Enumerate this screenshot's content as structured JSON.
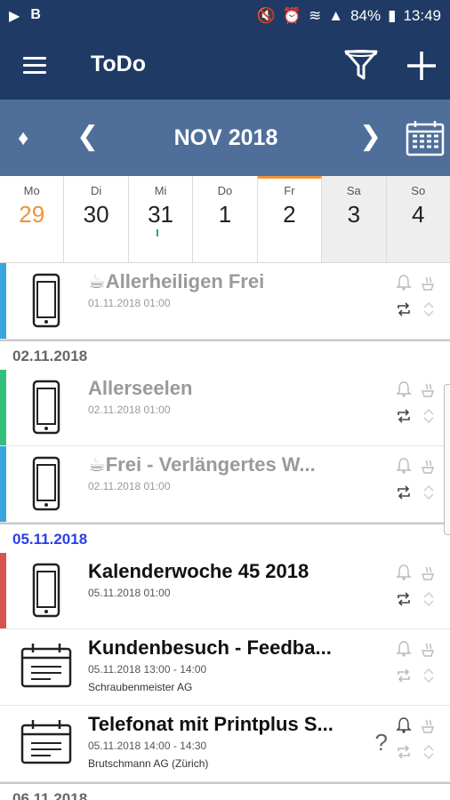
{
  "status_bar": {
    "left_icons": [
      "play-store-icon",
      "b-icon"
    ],
    "battery": "84%",
    "time": "13:49"
  },
  "app_bar": {
    "title": "ToDo",
    "menu_icon": "hamburger-icon",
    "filter_icon": "filter-icon",
    "add_icon": "plus-icon"
  },
  "month_bar": {
    "label": "NOV 2018",
    "prev": "❮",
    "next": "❯",
    "diamond": "♦"
  },
  "week": [
    {
      "name": "Mo",
      "num": "29"
    },
    {
      "name": "Di",
      "num": "30"
    },
    {
      "name": "Mi",
      "num": "31"
    },
    {
      "name": "Do",
      "num": "1"
    },
    {
      "name": "Fr",
      "num": "2"
    },
    {
      "name": "Sa",
      "num": "3"
    },
    {
      "name": "So",
      "num": "4"
    }
  ],
  "groups": [
    {
      "date": "",
      "items": [
        {
          "title": "☕Allerheiligen Frei",
          "time": "01.11.2018 01:00",
          "sub": "",
          "icon": "phone-icon",
          "stripe": "#3aa6e0",
          "muted": true
        }
      ]
    },
    {
      "date": "02.11.2018",
      "items": [
        {
          "title": "Allerseelen",
          "time": "02.11.2018 01:00",
          "sub": "",
          "icon": "phone-icon",
          "stripe": "#32c07a",
          "muted": true
        },
        {
          "title": "☕Frei - Verlängertes W...",
          "time": "02.11.2018 01:00",
          "sub": "",
          "icon": "phone-icon",
          "stripe": "#3aa6e0",
          "muted": true
        }
      ]
    },
    {
      "date": "05.11.2018",
      "items": [
        {
          "title": "Kalenderwoche 45 2018",
          "time": "05.11.2018 01:00",
          "sub": "",
          "icon": "phone-icon",
          "stripe": "#d9534f",
          "muted": false
        },
        {
          "title": "Kundenbesuch - Feedba...",
          "time": "05.11.2018 13:00 - 14:00",
          "sub": "Schraubenmeister AG",
          "icon": "calendar-icon",
          "stripe": "",
          "muted": false
        },
        {
          "title": "Telefonat mit Printplus S...",
          "time": "05.11.2018 14:00 - 14:30",
          "sub": "Brutschmann AG (Zürich)",
          "icon": "calendar-icon",
          "stripe": "",
          "muted": false,
          "question": "?"
        }
      ]
    },
    {
      "date": "06.11.2018",
      "items": []
    }
  ]
}
